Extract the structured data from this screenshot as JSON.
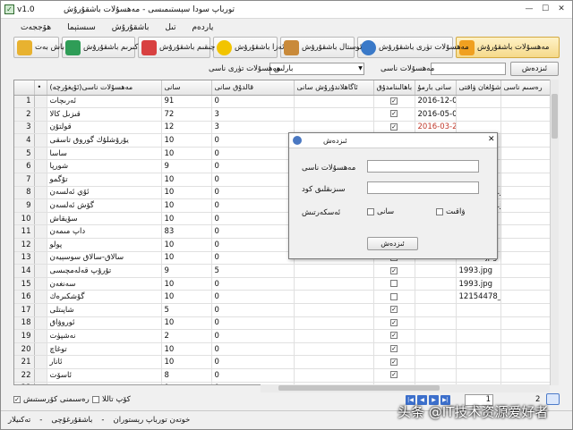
{
  "window": {
    "version": "v1.0",
    "title": "تورباپ سودا سېستىمىسى - مەھسۇلات باشقۇرۇش"
  },
  "menu": [
    "ھۆججەت",
    "سىستېما",
    "باشقۇرۇش",
    "تىل",
    "ياردەم"
  ],
  "toolbar": [
    {
      "label": "مەھسۇلات باشقۇرۇش",
      "icon": "products-icon",
      "color": "#f0a020",
      "active": true
    },
    {
      "label": "مەھسۇلات تۈرى باشقۇرۇش",
      "icon": "gear-icon",
      "color": "#3a79c8",
      "active": false
    },
    {
      "label": "ئوستال باشقۇرۇش",
      "icon": "table-icon",
      "color": "#c98a3a",
      "active": false
    },
    {
      "label": "ئەزا باشقۇرۇش",
      "icon": "member-icon",
      "color": "#f2c400",
      "active": false
    },
    {
      "label": "چىقىم باشقۇرۇش",
      "icon": "expense-icon",
      "color": "#d84040",
      "active": false
    },
    {
      "label": "كىرىم باشقۇرۇش",
      "icon": "income-icon",
      "color": "#2f9d57",
      "active": false
    },
    {
      "label": "باش بەت",
      "icon": "home-icon",
      "color": "#e8b230",
      "active": false
    }
  ],
  "search": {
    "button": "ئىزدەش",
    "field_label": "مەھسۇلات ناسى",
    "type_label": "مەھسۇلات تۈرى ناسى",
    "type_value": "بارلىق"
  },
  "grid": {
    "headers": [
      "",
      "•",
      "مەھسۇلات ناسى(ئۇيغۇرچە)",
      "سانى",
      "قالدۇق سانى",
      "ئاگاھلاندۇرۇش سانى",
      "باھالىنامدۇق",
      "سانى بارمۇ",
      "قوشۇلغان ۋاقتى",
      "رەسىم ناسى"
    ],
    "rows": [
      {
        "n": "1",
        "name": "ئەرىچات",
        "qty": "91",
        "remain": "0",
        "alert": "",
        "chk": true,
        "date": "2016-12-01 17:59",
        "img": "",
        "red": false
      },
      {
        "n": "2",
        "name": "قىزىل كالا",
        "qty": "72",
        "remain": "3",
        "alert": "",
        "chk": true,
        "date": "2016-05-01 00:00",
        "img": "",
        "red": false
      },
      {
        "n": "3",
        "name": "قولتۇن",
        "qty": "12",
        "remain": "3",
        "alert": "",
        "chk": true,
        "date": "2016-03-28 19:24",
        "img": "",
        "red": true
      },
      {
        "n": "4",
        "name": "يۇرۇشلۇك گوروق تاسقى",
        "qty": "10",
        "remain": "0",
        "alert": "",
        "chk": false,
        "date": "",
        "img": "tcmf.jpg",
        "red": false
      },
      {
        "n": "5",
        "name": "ساسا",
        "qty": "10",
        "remain": "0",
        "alert": "",
        "chk": false,
        "date": "",
        "img": "samsa.jpg",
        "red": false
      },
      {
        "n": "6",
        "name": "شورپا",
        "qty": "9",
        "remain": "0",
        "alert": "",
        "chk": false,
        "date": "",
        "img": "rttp.jpg",
        "red": false
      },
      {
        "n": "7",
        "name": "تۇگمو",
        "qty": "10",
        "remain": "0",
        "alert": "",
        "chk": false,
        "date": "",
        "img": "qtm.jpg",
        "red": false
      },
      {
        "n": "8",
        "name": "ئۆي ئەلسەن",
        "qty": "10",
        "remain": "0",
        "alert": "",
        "chk": false,
        "date": "",
        "img": "P2100184.jpg",
        "red": false
      },
      {
        "n": "9",
        "name": "گۆش ئەلسەن",
        "qty": "10",
        "remain": "0",
        "alert": "",
        "chk": false,
        "date": "",
        "img": "P2100184.jpg",
        "red": false
      },
      {
        "n": "10",
        "name": "سۆيقاش",
        "qty": "10",
        "remain": "0",
        "alert": "",
        "chk": false,
        "date": "",
        "img": "hm.jpg",
        "red": false
      },
      {
        "n": "11",
        "name": "داپ مىمەن",
        "qty": "83",
        "remain": "0",
        "alert": "",
        "chk": false,
        "date": "",
        "img": "dpj.jpg",
        "red": false
      },
      {
        "n": "12",
        "name": "پولو",
        "qty": "10",
        "remain": "0",
        "alert": "",
        "chk": false,
        "date": "",
        "img": "62220.jpg",
        "red": false
      },
      {
        "n": "13",
        "name": "سالاق-سالاق سوسېيەن",
        "qty": "10",
        "remain": "0",
        "alert": "",
        "chk": false,
        "date": "",
        "img": "62220.jpg",
        "red": false
      },
      {
        "n": "14",
        "name": "تۇرۇپ قەلەمچىسى",
        "qty": "9",
        "remain": "5",
        "alert": "",
        "chk": true,
        "date": "",
        "img": "1993.jpg",
        "red": false
      },
      {
        "n": "15",
        "name": "سەنغەن",
        "qty": "10",
        "remain": "0",
        "alert": "",
        "chk": false,
        "date": "",
        "img": "1993.jpg",
        "red": false
      },
      {
        "n": "16",
        "name": "گۆشكىرەك",
        "qty": "10",
        "remain": "0",
        "alert": "",
        "chk": false,
        "date": "",
        "img": "12154478_1.j",
        "red": false
      },
      {
        "n": "17",
        "name": "شاپىتلى",
        "qty": "5",
        "remain": "0",
        "alert": "",
        "chk": true,
        "date": "",
        "img": "",
        "red": false
      },
      {
        "n": "18",
        "name": "ئوروۋاق",
        "qty": "10",
        "remain": "0",
        "alert": "",
        "chk": true,
        "date": "",
        "img": "",
        "red": false
      },
      {
        "n": "19",
        "name": "نەشپۈت",
        "qty": "2",
        "remain": "0",
        "alert": "",
        "chk": true,
        "date": "",
        "img": "",
        "red": false
      },
      {
        "n": "20",
        "name": "توغاچ",
        "qty": "10",
        "remain": "0",
        "alert": "",
        "chk": true,
        "date": "",
        "img": "",
        "red": false
      },
      {
        "n": "21",
        "name": "ئانار",
        "qty": "10",
        "remain": "0",
        "alert": "",
        "chk": true,
        "date": "",
        "img": "",
        "red": false
      },
      {
        "n": "22",
        "name": "ئاسۆت",
        "qty": "8",
        "remain": "0",
        "alert": "",
        "chk": true,
        "date": "",
        "img": "",
        "red": false
      },
      {
        "n": "23",
        "name": "",
        "qty": "9",
        "remain": "0",
        "alert": "",
        "chk": true,
        "date": "",
        "img": "",
        "red": false
      }
    ]
  },
  "dialog": {
    "title": "ئىزدەش",
    "name_label": "مەھسۇلات ناسى",
    "code_label": "سىزىقلىق كود",
    "condition_label": "ئەسكەرتىش",
    "opt_qty": "سانى",
    "opt_time": "ۋاقىت",
    "button": "ئىزدەش"
  },
  "bottom": {
    "show_images": "رەسىمنى كۆرسىتىش",
    "multi_select": "كۆپ تاللا",
    "page_current": "1",
    "page_total": "2"
  },
  "status": [
    "تەكىيلار",
    "باشقۇرغۇچى",
    "خوتەن تورباپ رېستوران"
  ],
  "watermark": "头条 @IT技术资源爱好者"
}
